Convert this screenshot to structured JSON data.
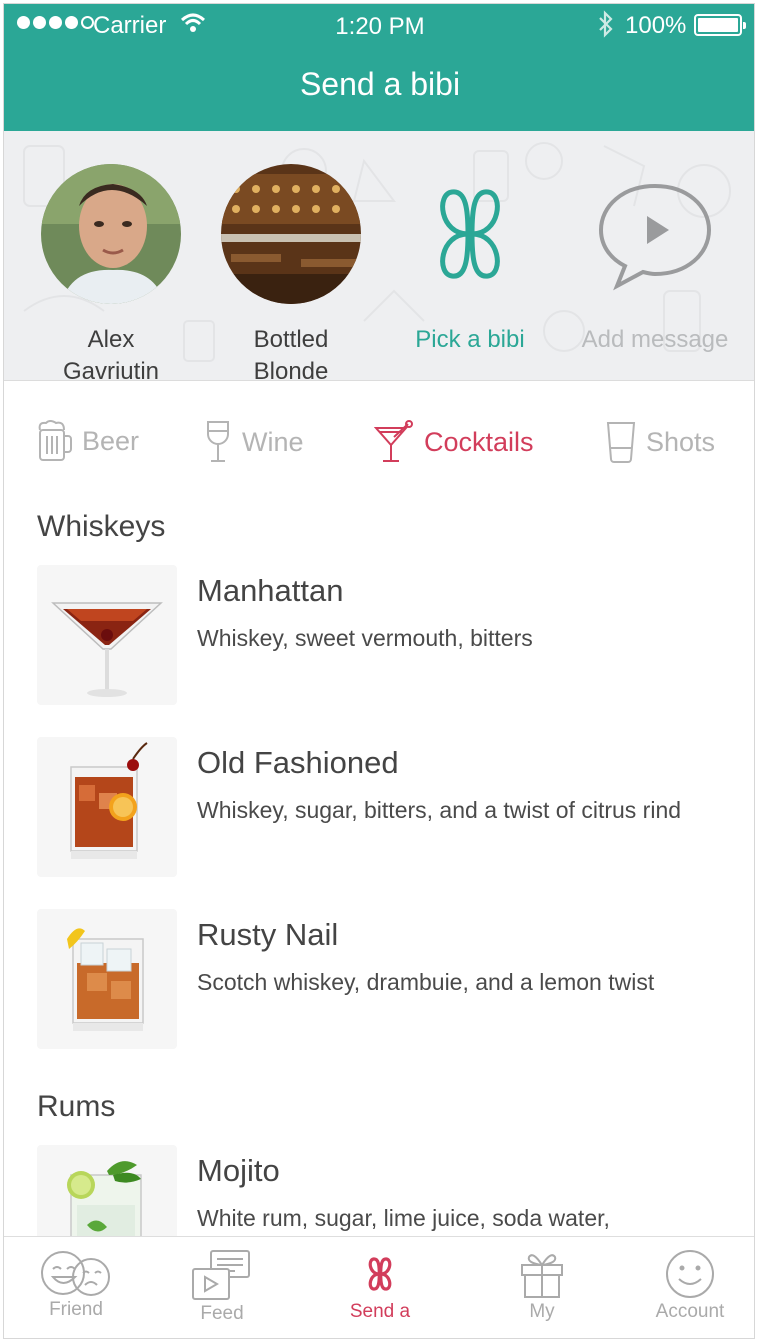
{
  "status_bar": {
    "carrier": "Carrier",
    "time": "1:20 PM",
    "battery": "100%"
  },
  "header": {
    "title": "Send a bibi"
  },
  "recipients": {
    "friend": {
      "name_line1": "Alex",
      "name_line2": "Gavriutin"
    },
    "venue": {
      "name_line1": "Bottled",
      "name_line2": "Blonde"
    },
    "pick": {
      "label": "Pick a bibi"
    },
    "message": {
      "label": "Add message"
    }
  },
  "categories": [
    {
      "label": "Beer",
      "icon": "beer-mug-icon",
      "active": false
    },
    {
      "label": "Wine",
      "icon": "wine-glass-icon",
      "active": false
    },
    {
      "label": "Cocktails",
      "icon": "cocktail-glass-icon",
      "active": true
    },
    {
      "label": "Shots",
      "icon": "shot-glass-icon",
      "active": false
    }
  ],
  "sections": [
    {
      "title": "Whiskeys",
      "items": [
        {
          "name": "Manhattan",
          "description": "Whiskey, sweet vermouth, bitters"
        },
        {
          "name": "Old Fashioned",
          "description": "Whiskey, sugar, bitters, and a twist of citrus rind"
        },
        {
          "name": "Rusty Nail",
          "description": "Scotch whiskey, drambuie, and a lemon twist"
        }
      ]
    },
    {
      "title": "Rums",
      "items": [
        {
          "name": "Mojito",
          "description": "White rum, sugar, lime juice, soda water,"
        }
      ]
    }
  ],
  "tabs": [
    {
      "label": "Friend",
      "icon": "friend-faces-icon",
      "active": false
    },
    {
      "label": "Feed",
      "icon": "feed-icon",
      "active": false
    },
    {
      "label": "Send a",
      "icon": "bibi-logo-icon",
      "active": true
    },
    {
      "label": "My",
      "icon": "gift-icon",
      "active": false
    },
    {
      "label": "Account",
      "icon": "smiley-icon",
      "active": false
    }
  ],
  "colors": {
    "brand_teal": "#2ba796",
    "accent_red": "#d23d5b",
    "inactive_grey": "#b4b4b4"
  }
}
